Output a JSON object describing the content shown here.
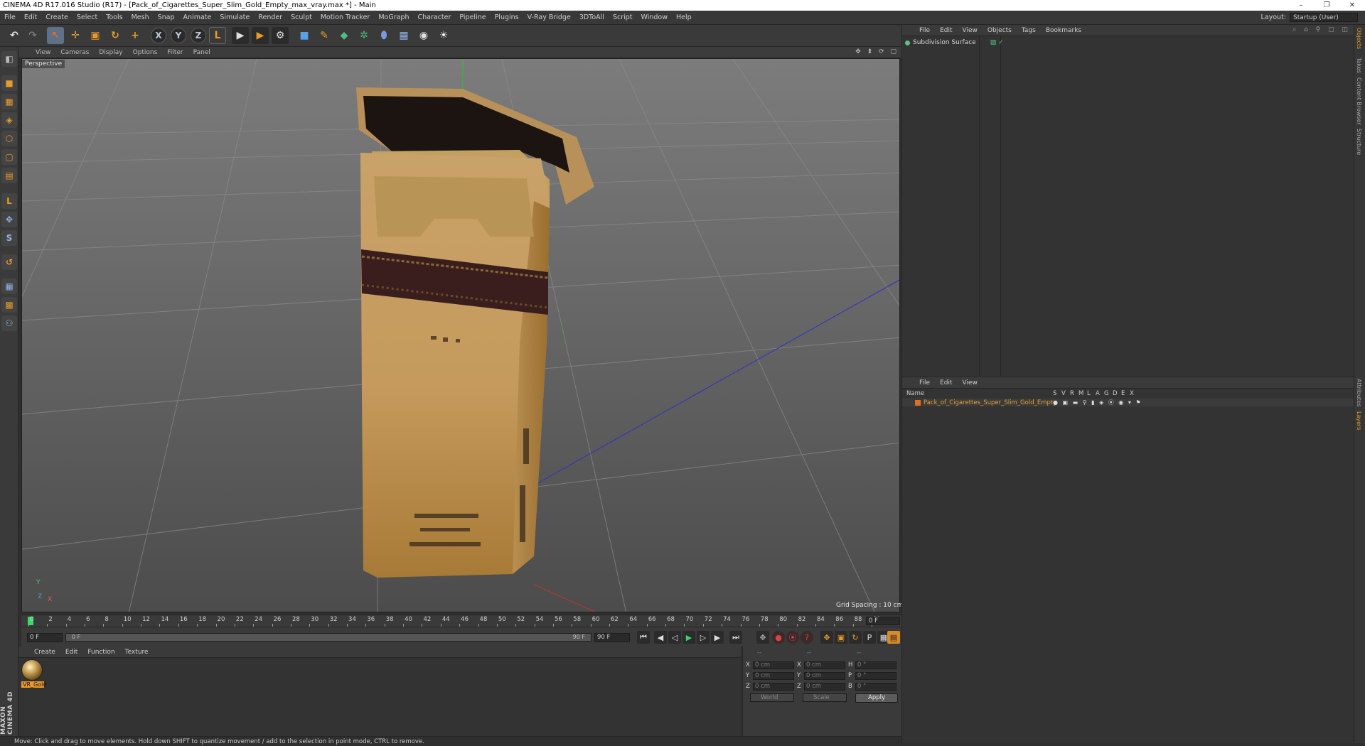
{
  "window": {
    "title": "CINEMA 4D R17.016 Studio (R17) - [Pack_of_Cigarettes_Super_Slim_Gold_Empty_max_vray.max *] - Main",
    "minimize": "–",
    "restore": "❐",
    "close": "✕"
  },
  "menu": [
    "File",
    "Edit",
    "Create",
    "Select",
    "Tools",
    "Mesh",
    "Snap",
    "Animate",
    "Simulate",
    "Render",
    "Sculpt",
    "Motion Tracker",
    "MoGraph",
    "Character",
    "Pipeline",
    "Plugins",
    "V-Ray Bridge",
    "3DToAll",
    "Script",
    "Window",
    "Help"
  ],
  "layout": {
    "label": "Layout:",
    "value": "Startup (User)"
  },
  "toolbar": {
    "undo": "↶",
    "redo": "↷",
    "select": "↖",
    "move": "✛",
    "scale": "▣",
    "rotate": "↻",
    "transform": "+",
    "axis_x": "X",
    "axis_y": "Y",
    "axis_z": "Z",
    "coord": "L",
    "render_view": "▶",
    "render_pic": "▶",
    "render_settings": "⚙",
    "cube": "■",
    "pen": "✎",
    "subdiv": "◆",
    "array": "✲",
    "deformer": "⬮",
    "floor": "▦",
    "camera": "◉",
    "light": "☀",
    "colors": {
      "active": "#5f7088",
      "axis_text": "#b9c4d8"
    }
  },
  "lefttools": [
    "◧",
    "■",
    "▦",
    "◈",
    "⬡",
    "▢",
    "▤",
    "L",
    "✥",
    "S",
    "↺",
    "▦",
    "▩",
    "⚇"
  ],
  "viewport": {
    "menu": [
      "View",
      "Cameras",
      "Display",
      "Options",
      "Filter",
      "Panel"
    ],
    "nav_icons": "✥ ⬍ ⟳ ▢",
    "label": "Perspective",
    "grid_spacing": "Grid Spacing : 10 cm",
    "axis_y": "Y",
    "axis_z": "Z",
    "axis_x": "X"
  },
  "timeline": {
    "ticks": [
      "0",
      "2",
      "4",
      "6",
      "8",
      "10",
      "12",
      "14",
      "16",
      "18",
      "20",
      "22",
      "24",
      "26",
      "28",
      "30",
      "32",
      "34",
      "36",
      "38",
      "40",
      "42",
      "44",
      "46",
      "48",
      "50",
      "52",
      "54",
      "56",
      "58",
      "60",
      "62",
      "64",
      "66",
      "68",
      "70",
      "72",
      "74",
      "76",
      "78",
      "80",
      "82",
      "84",
      "86",
      "88",
      "90"
    ],
    "current_frame": "0 F",
    "start_field": "0 F",
    "range_start": "0 F",
    "range_end": "90 F",
    "end_field": "90 F",
    "buttons": {
      "first": "⏮",
      "prev_key": "◀",
      "prev": "◁",
      "play": "▶",
      "next": "▷",
      "next_key": "▶",
      "last": "⏭",
      "rec_key": "●",
      "auto_key": "⦿",
      "help_key": "?",
      "pos": "✥",
      "scale": "▣",
      "rot": "↻",
      "param": "P",
      "pla": "▦",
      "layout": "▤"
    }
  },
  "materials": {
    "menu": [
      "Create",
      "Edit",
      "Function",
      "Texture"
    ],
    "items": [
      {
        "name": "VR_Gold"
      }
    ]
  },
  "coordinates": {
    "headers": [
      "--",
      "--",
      "--"
    ],
    "rows": [
      {
        "l1": "X",
        "v1": "0 cm",
        "l2": "X",
        "v2": "0 cm",
        "l3": "H",
        "v3": "0 °"
      },
      {
        "l1": "Y",
        "v1": "0 cm",
        "l2": "Y",
        "v2": "0 cm",
        "l3": "P",
        "v3": "0 °"
      },
      {
        "l1": "Z",
        "v1": "0 cm",
        "l2": "Z",
        "v2": "0 cm",
        "l3": "B",
        "v3": "0 °"
      }
    ],
    "space": "World",
    "mode": "Scale",
    "apply": "Apply"
  },
  "object_manager": {
    "menu": [
      "File",
      "Edit",
      "View",
      "Objects",
      "Tags",
      "Bookmarks"
    ],
    "tool_icons": "⌕ ⌂ ⚲ ▢ ◫",
    "objects": [
      {
        "name": "Subdivision Surface",
        "tag_icons": "▨ ✓"
      }
    ]
  },
  "layer_manager": {
    "menu": [
      "File",
      "Edit",
      "View"
    ],
    "columns": {
      "name": "Name",
      "flags": [
        "S",
        "V",
        "R",
        "M",
        "L",
        "A",
        "G",
        "D",
        "E",
        "X"
      ]
    },
    "layers": [
      {
        "name": "Pack_of_Cigarettes_Super_Slim_Gold_Empty",
        "icons": "● ▣ ▬ ⚲ ▮ ◈ ⦿ ◉ ▾ ⚑"
      }
    ]
  },
  "sidetabs": [
    "Objects",
    "Takes",
    "Content Browser",
    "Structure",
    "Attributes",
    "Layers"
  ],
  "status": "Move: Click and drag to move elements. Hold down SHIFT to quantize movement / add to the selection in point mode, CTRL to remove.",
  "brand": "MAXON CINEMA 4D"
}
